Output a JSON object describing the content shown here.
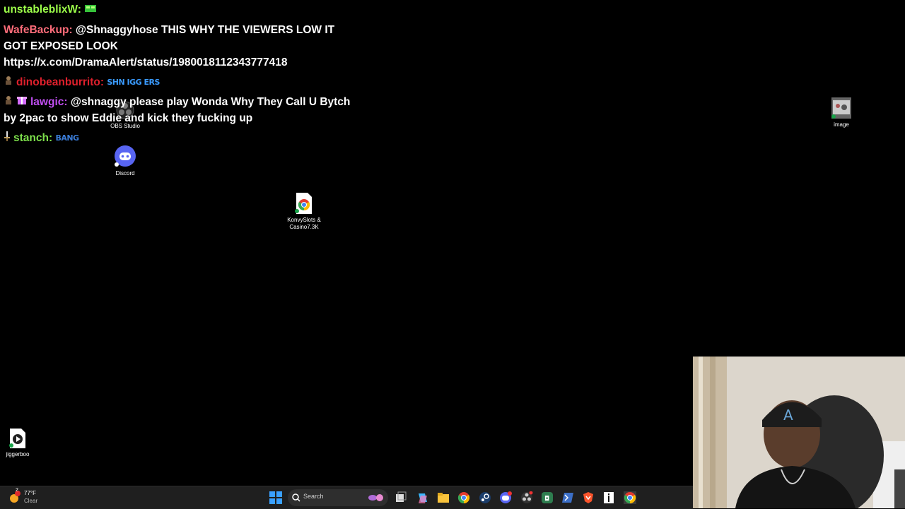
{
  "chat": {
    "messages": [
      {
        "user": "unstableblixW:",
        "user_color": "#9dff4a",
        "text": "",
        "badge": "",
        "emote": ""
      },
      {
        "user": "WafeBackup:",
        "user_color": "#ff6d7a",
        "text": "@Shnaggyhose THIS WHY THE VIEWERS LOW IT GOT EXPOSED LOOK https://x.com/DramaAlert/status/1980018112343777418",
        "badge": "",
        "emote": ""
      },
      {
        "user": "dinobeanburrito:",
        "user_color": "#e0202c",
        "text": "",
        "badge": "figure",
        "emote": "SHN IGG ERS"
      },
      {
        "user": "lawgic:",
        "user_color": "#c04ef2",
        "text": "@shnaggy please play Wonda Why They Call U Bytch by 2pac to show Eddie and kick they fucking up",
        "badge": "figure+gift",
        "emote": ""
      },
      {
        "user": "stanch:",
        "user_color": "#7de04b",
        "text": "",
        "badge": "sword",
        "emote": "BANG"
      }
    ]
  },
  "desktop": {
    "icons": [
      {
        "name": "obs-studio",
        "label": "OBS Studio"
      },
      {
        "name": "discord",
        "label": "Discord"
      },
      {
        "name": "image",
        "label": "image"
      },
      {
        "name": "konvyslots",
        "label": "KonvySlots & Casino7.3K"
      },
      {
        "name": "jiggerboo",
        "label": "jiggerboo"
      }
    ]
  },
  "taskbar": {
    "weather": {
      "temp": "77°F",
      "condition": "Clear",
      "notif_count": "2"
    },
    "search_placeholder": "Search",
    "pinned": [
      "windows-start-icon",
      "search-icon",
      "task-view-icon",
      "copilot-icon",
      "file-explorer-icon",
      "chrome-icon",
      "steam-icon",
      "discord-icon",
      "obs-icon",
      "app-icon",
      "powershell-icon",
      "brave-icon",
      "info-icon",
      "chrome-active-icon"
    ]
  },
  "colors": {
    "taskbar": "#1f1f1f",
    "accent": "#4cc2ff"
  }
}
